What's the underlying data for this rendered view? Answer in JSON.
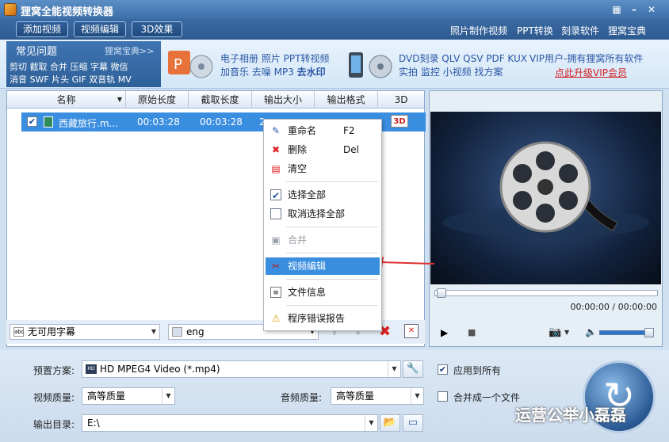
{
  "app": {
    "title": "狸窝全能视频转换器"
  },
  "toolbar": {
    "add_video": "添加视频",
    "edit_video": "视频编辑",
    "effect_3d": "3D效果"
  },
  "top_links": [
    "照片制作视频",
    "PPT转换",
    "刻录软件",
    "狸窝宝典"
  ],
  "faq": {
    "title": "常见问题",
    "more": "狸窝宝典>>",
    "line1": "剪切 截取 合并 压缩 字幕 微信",
    "line2": "消音 SWF 片头 GIF 双音轨 MV"
  },
  "promo": {
    "a_line1": "电子相册 照片 PPT转视频",
    "a_line2_prefix": "加音乐 去噪 MP3 ",
    "a_line2_bold": "去水印",
    "b_line1": "DVD刻录 QLV QSV PDF KUX",
    "b_line2": "实拍 监控 小视频 找方案",
    "vip_line": "VIP用户-拥有狸窝所有软件",
    "vip_link": "点此升级VIP会员"
  },
  "table": {
    "columns": [
      "名称",
      "原始长度",
      "截取长度",
      "输出大小",
      "输出格式",
      "3D"
    ],
    "rows": [
      {
        "name": "西藏旅行.m...",
        "original_length": "00:03:28",
        "clip_length": "00:03:28",
        "output_size": "2...",
        "output_format": "",
        "three_d": "3D"
      }
    ]
  },
  "context_menu": [
    {
      "label": "重命名",
      "shortcut": "F2",
      "icon": "rename-icon"
    },
    {
      "label": "删除",
      "shortcut": "Del",
      "icon": "delete-icon"
    },
    {
      "label": "清空",
      "shortcut": "",
      "icon": "clear-icon"
    },
    {
      "label": "选择全部",
      "shortcut": "",
      "icon": "checkbox-checked-icon"
    },
    {
      "label": "取消选择全部",
      "shortcut": "",
      "icon": "checkbox-empty-icon"
    },
    {
      "label": "合并",
      "shortcut": "",
      "icon": "merge-icon",
      "disabled": true
    },
    {
      "label": "视频编辑",
      "shortcut": "",
      "icon": "scissors-icon",
      "highlighted": true
    },
    {
      "label": "文件信息",
      "shortcut": "",
      "icon": "file-info-icon"
    },
    {
      "label": "程序错误报告",
      "shortcut": "",
      "icon": "warning-icon"
    }
  ],
  "subtitle_bar": {
    "subtitle": "无可用字幕",
    "audio": "eng"
  },
  "player": {
    "time": "00:00:00 / 00:00:00",
    "progress": 0,
    "volume": 0.85
  },
  "settings": {
    "preset_label": "预置方案:",
    "preset_value": "HD MPEG4 Video (*.mp4)",
    "apply_all": "应用到所有",
    "video_quality_label": "视频质量:",
    "video_quality": "高等质量",
    "audio_quality_label": "音频质量:",
    "audio_quality": "高等质量",
    "merge_one": "合并成一个文件",
    "output_dir_label": "输出目录:",
    "output_dir": "E:\\"
  },
  "watermark": "运营公举小磊磊",
  "colors": {
    "accent": "#3a8ee0",
    "title_bar": "#3d6fa8",
    "link_red": "#d41e1e"
  }
}
